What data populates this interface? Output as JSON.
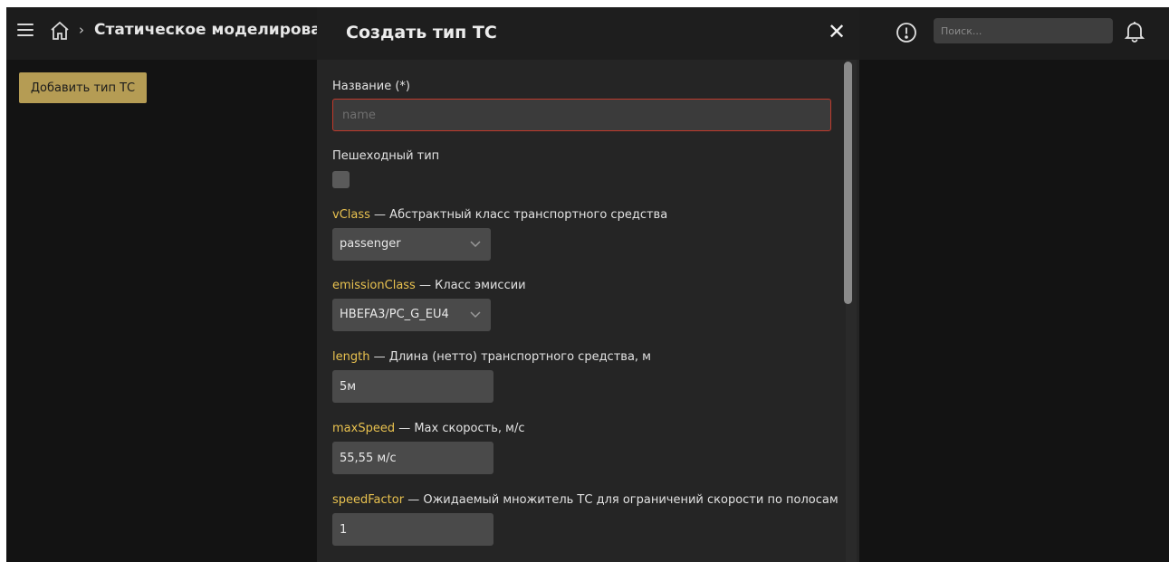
{
  "topbar": {
    "breadcrumb_separator": "›",
    "title": "Статическое моделирован",
    "search_placeholder": "Поиск..."
  },
  "main": {
    "add_button_label": "Добавить тип ТС"
  },
  "modal": {
    "title": "Создать тип ТС",
    "close_glyph": "✕",
    "fields": {
      "name": {
        "label": "Название (*)",
        "placeholder": "name"
      },
      "pedestrian": {
        "label": "Пешеходный тип",
        "checked": false
      },
      "vclass": {
        "key": "vClass",
        "desc": " — Абстрактный класс транспортного средства",
        "value": "passenger"
      },
      "emission": {
        "key": "emissionClass",
        "desc": " — Класс эмиссии",
        "value": "HBEFA3/PC_G_EU4"
      },
      "length": {
        "key": "length",
        "desc": " — Длина (нетто) транспортного средства, м",
        "value": "5м"
      },
      "maxspeed": {
        "key": "maxSpeed",
        "desc": " — Max скорость, м/с",
        "value": "55,55 м/с"
      },
      "speedfactor": {
        "key": "speedFactor",
        "desc": " — Ожидаемый множитель ТС для ограничений скорости по полосам",
        "value": "1"
      }
    }
  },
  "colors": {
    "accent_button": "#b59c54",
    "field_key": "#e8c14f",
    "error_border": "#c0392b"
  }
}
